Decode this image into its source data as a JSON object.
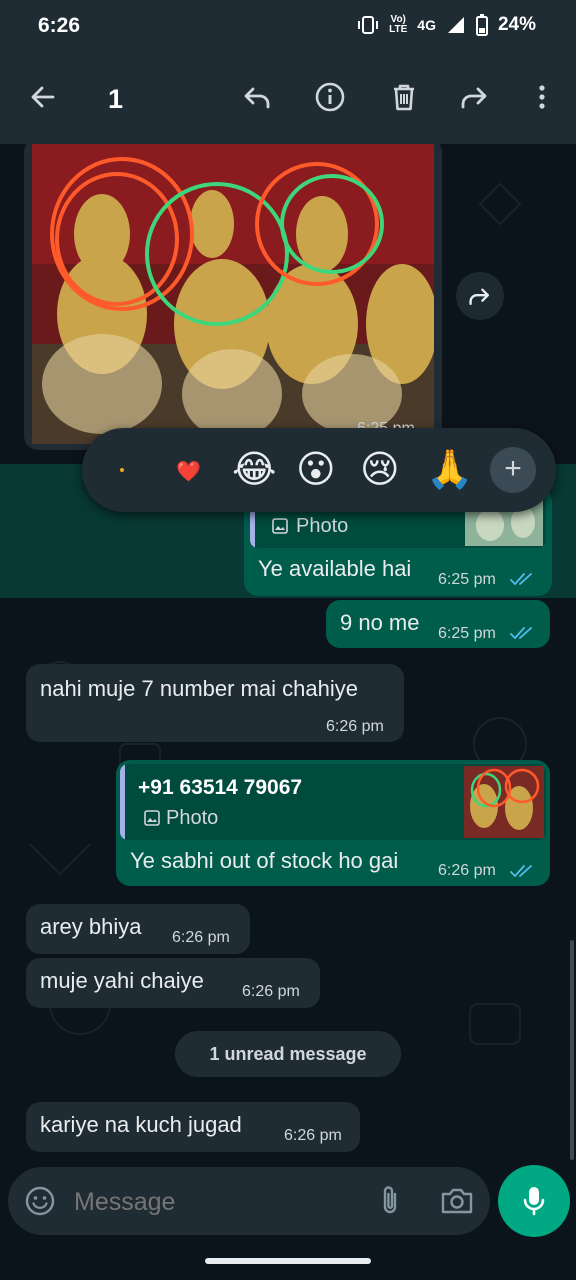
{
  "status_bar": {
    "time": "6:26",
    "network_top": "Vo)",
    "network_bottom": "LTE",
    "network_type": "4G",
    "battery": "24%"
  },
  "app_bar": {
    "selected_count": "1",
    "icons": [
      "back-arrow-icon",
      "reply-icon",
      "info-icon",
      "delete-icon",
      "forward-icon",
      "more-options-icon"
    ]
  },
  "reactions": {
    "emojis": [
      "❤️",
      "😂",
      "😮",
      "😢",
      "🙏"
    ],
    "add_label": "+"
  },
  "messages": [
    {
      "direction": "in",
      "type": "image",
      "time": "6:25 pm"
    },
    {
      "direction": "out",
      "quote_label": "Photo",
      "text": "Ye available hai",
      "time": "6:25 pm"
    },
    {
      "direction": "out",
      "text": "9 no me",
      "time": "6:25 pm"
    },
    {
      "direction": "in",
      "text": "nahi muje 7 number mai chahiye",
      "time": "6:26 pm"
    },
    {
      "direction": "out",
      "quote_author": "+91 63514 79067",
      "quote_label": "Photo",
      "text": "Ye sabhi out of stock ho gai",
      "time": "6:26 pm"
    },
    {
      "direction": "in",
      "text": "arey bhiya",
      "time": "6:26 pm"
    },
    {
      "direction": "in",
      "text": "muje yahi chaiye",
      "time": "6:26 pm"
    },
    {
      "direction": "in",
      "text": "kariye na kuch jugad",
      "time": "6:26 pm"
    }
  ],
  "unread_label": "1 unread message",
  "composer": {
    "placeholder": "Message"
  },
  "colors": {
    "outgoing": "#005c4b",
    "incoming": "#1f2c34",
    "accent": "#00a884",
    "read_ticks": "#53bdeb"
  }
}
